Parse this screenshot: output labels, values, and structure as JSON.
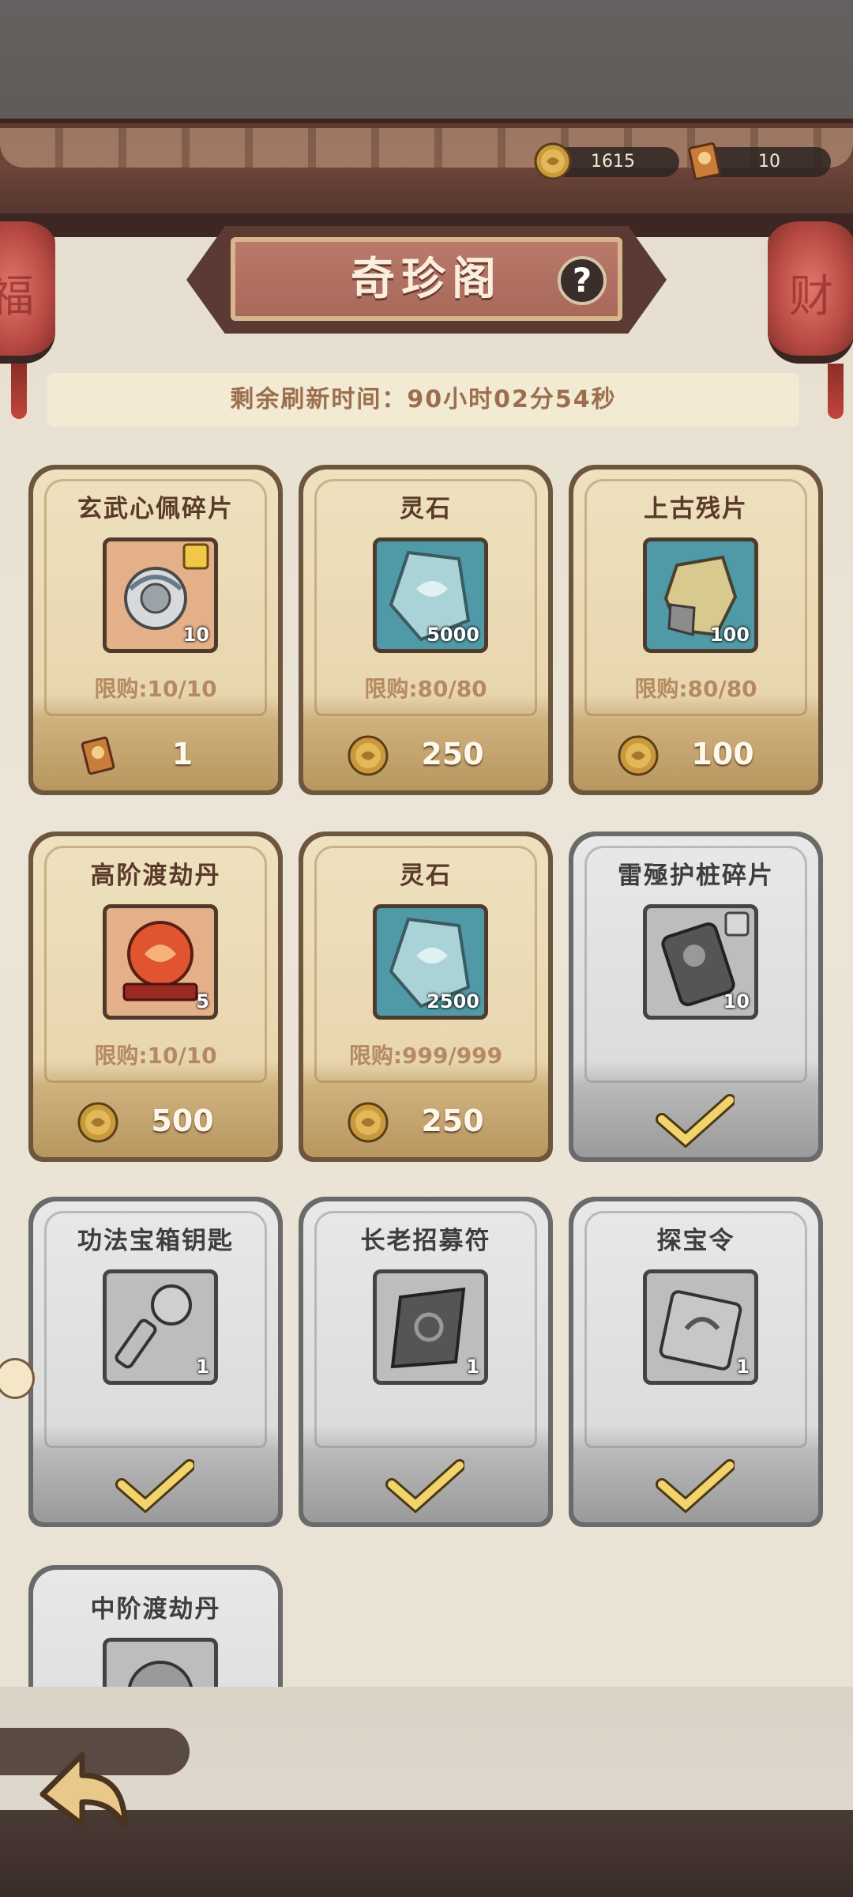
{
  "currency": {
    "coin": {
      "icon": "coin-icon",
      "value": "1615"
    },
    "ticket": {
      "icon": "ticket-icon",
      "value": "10"
    }
  },
  "lanterns": {
    "left": "福",
    "right": "财"
  },
  "header": {
    "title": "奇珍阁",
    "help": "?"
  },
  "refresh": {
    "text": "剩余刷新时间：90小时02分54秒"
  },
  "shop_items": [
    {
      "name": "玄武心佩碎片",
      "icon": "jade-pendant-fragment-icon",
      "qty": "10",
      "limit": "限购:10/10",
      "currency": "ticket",
      "price": "1",
      "sold_out": false
    },
    {
      "name": "灵石",
      "icon": "spirit-stone-icon",
      "qty": "5000",
      "limit": "限购:80/80",
      "currency": "coin",
      "price": "250",
      "sold_out": false
    },
    {
      "name": "上古残片",
      "icon": "ancient-fragment-icon",
      "qty": "100",
      "limit": "限购:80/80",
      "currency": "coin",
      "price": "100",
      "sold_out": false
    },
    {
      "name": "高阶渡劫丹",
      "icon": "red-pill-orb-icon",
      "qty": "5",
      "limit": "限购:10/10",
      "currency": "coin",
      "price": "500",
      "sold_out": false
    },
    {
      "name": "灵石",
      "icon": "spirit-stone-icon",
      "qty": "2500",
      "limit": "限购:999/999",
      "currency": "coin",
      "price": "250",
      "sold_out": false
    },
    {
      "name": "雷殛护桩碎片",
      "icon": "thunder-stake-fragment-icon",
      "qty": "10",
      "sold_out": true
    },
    {
      "name": "功法宝箱钥匙",
      "icon": "chest-key-icon",
      "qty": "1",
      "sold_out": true
    },
    {
      "name": "长老招募符",
      "icon": "elder-recruit-talisman-icon",
      "qty": "1",
      "sold_out": true
    },
    {
      "name": "探宝令",
      "icon": "treasure-token-icon",
      "qty": "1",
      "sold_out": true
    },
    {
      "name": "中阶渡劫丹",
      "icon": "mid-pill-orb-icon",
      "sold_out": true
    }
  ],
  "colors": {
    "card_active": "#e8d6ae",
    "card_sold": "#dcdcdc",
    "limit_text": "#b58a62",
    "title_bg": "#b97a6a"
  },
  "footer": {
    "back_icon": "back-arrow-icon"
  }
}
